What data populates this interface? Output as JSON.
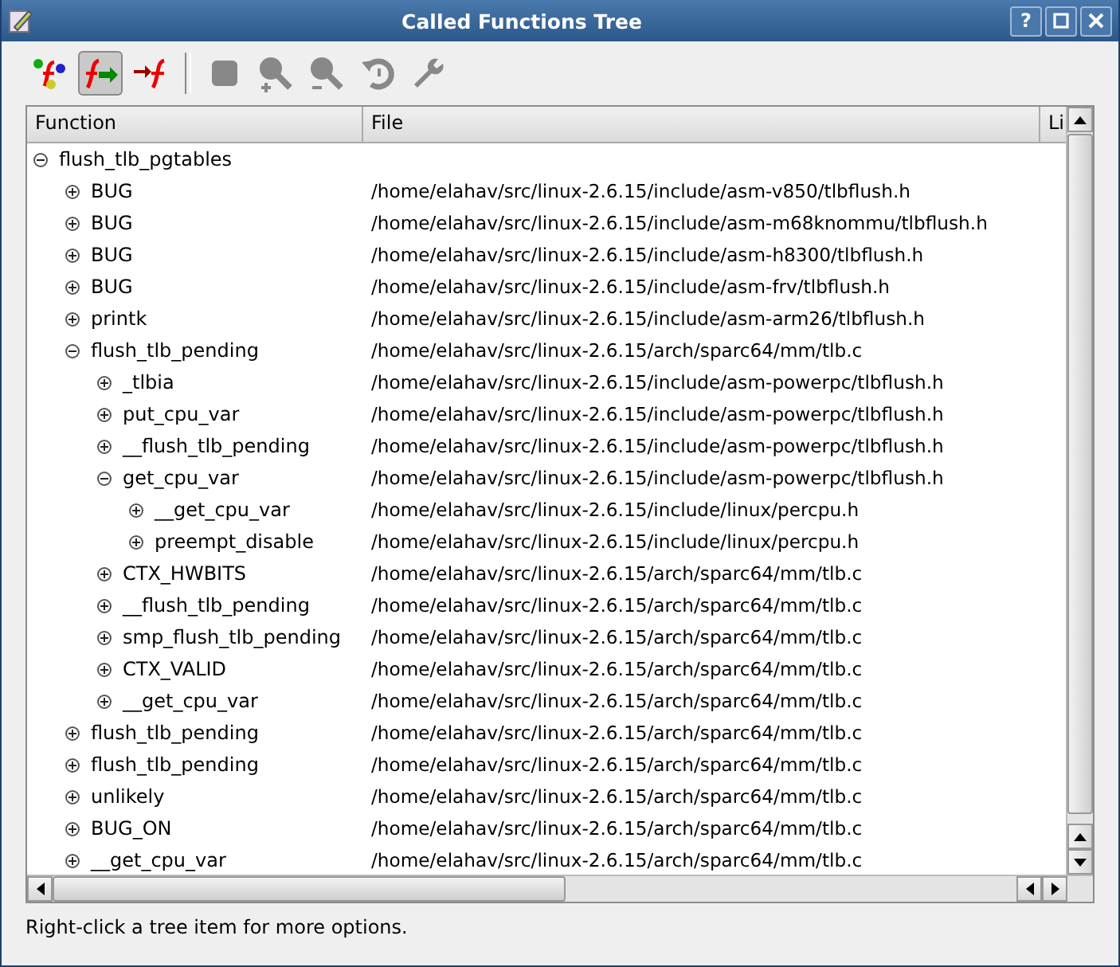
{
  "window": {
    "title": "Called Functions Tree",
    "buttons": [
      "?"
    ]
  },
  "toolbar": [
    {
      "kind": "graph",
      "selected": false,
      "disabled": false
    },
    {
      "kind": "called",
      "selected": true,
      "disabled": false
    },
    {
      "kind": "calling",
      "selected": false,
      "disabled": false
    },
    {
      "kind": "stop",
      "selected": false,
      "disabled": true
    },
    {
      "kind": "zoomin",
      "selected": false,
      "disabled": true
    },
    {
      "kind": "zoomout",
      "selected": false,
      "disabled": true
    },
    {
      "kind": "restore",
      "selected": false,
      "disabled": true
    },
    {
      "kind": "settings",
      "selected": false,
      "disabled": true
    }
  ],
  "tree": {
    "columns": [
      "Function",
      "File",
      "Li"
    ],
    "rows": [
      {
        "name": "flush_tlb_pgtables",
        "expanded": true,
        "children": [
          {
            "name": "BUG",
            "file": "/home/elahav/src/linux-2.6.15/include/asm-v850/tlbflush.h",
            "expanded": false
          },
          {
            "name": "BUG",
            "file": "/home/elahav/src/linux-2.6.15/include/asm-m68knommu/tlbflush.h",
            "expanded": false
          },
          {
            "name": "BUG",
            "file": "/home/elahav/src/linux-2.6.15/include/asm-h8300/tlbflush.h",
            "expanded": false
          },
          {
            "name": "BUG",
            "file": "/home/elahav/src/linux-2.6.15/include/asm-frv/tlbflush.h",
            "expanded": false
          },
          {
            "name": "printk",
            "file": "/home/elahav/src/linux-2.6.15/include/asm-arm26/tlbflush.h",
            "expanded": false
          },
          {
            "name": "flush_tlb_pending",
            "file": "/home/elahav/src/linux-2.6.15/arch/sparc64/mm/tlb.c",
            "expanded": true,
            "children": [
              {
                "name": "_tlbia",
                "file": "/home/elahav/src/linux-2.6.15/include/asm-powerpc/tlbflush.h",
                "expanded": false
              },
              {
                "name": "put_cpu_var",
                "file": "/home/elahav/src/linux-2.6.15/include/asm-powerpc/tlbflush.h",
                "expanded": false
              },
              {
                "name": "__flush_tlb_pending",
                "file": "/home/elahav/src/linux-2.6.15/include/asm-powerpc/tlbflush.h",
                "expanded": false
              },
              {
                "name": "get_cpu_var",
                "file": "/home/elahav/src/linux-2.6.15/include/asm-powerpc/tlbflush.h",
                "expanded": true,
                "children": [
                  {
                    "name": "__get_cpu_var",
                    "file": "/home/elahav/src/linux-2.6.15/include/linux/percpu.h",
                    "expanded": false
                  },
                  {
                    "name": "preempt_disable",
                    "file": "/home/elahav/src/linux-2.6.15/include/linux/percpu.h",
                    "expanded": false
                  }
                ]
              },
              {
                "name": "CTX_HWBITS",
                "file": "/home/elahav/src/linux-2.6.15/arch/sparc64/mm/tlb.c",
                "expanded": false
              },
              {
                "name": "__flush_tlb_pending",
                "file": "/home/elahav/src/linux-2.6.15/arch/sparc64/mm/tlb.c",
                "expanded": false
              },
              {
                "name": "smp_flush_tlb_pending",
                "file": "/home/elahav/src/linux-2.6.15/arch/sparc64/mm/tlb.c",
                "expanded": false
              },
              {
                "name": "CTX_VALID",
                "file": "/home/elahav/src/linux-2.6.15/arch/sparc64/mm/tlb.c",
                "expanded": false
              },
              {
                "name": "__get_cpu_var",
                "file": "/home/elahav/src/linux-2.6.15/arch/sparc64/mm/tlb.c",
                "expanded": false
              }
            ]
          },
          {
            "name": "flush_tlb_pending",
            "file": "/home/elahav/src/linux-2.6.15/arch/sparc64/mm/tlb.c",
            "expanded": false
          },
          {
            "name": "flush_tlb_pending",
            "file": "/home/elahav/src/linux-2.6.15/arch/sparc64/mm/tlb.c",
            "expanded": false
          },
          {
            "name": "unlikely",
            "file": "/home/elahav/src/linux-2.6.15/arch/sparc64/mm/tlb.c",
            "expanded": false
          },
          {
            "name": "BUG_ON",
            "file": "/home/elahav/src/linux-2.6.15/arch/sparc64/mm/tlb.c",
            "expanded": false
          },
          {
            "name": "__get_cpu_var",
            "file": "/home/elahav/src/linux-2.6.15/arch/sparc64/mm/tlb.c",
            "expanded": false
          }
        ]
      }
    ]
  },
  "status_bar": "Right-click a tree item for more options."
}
